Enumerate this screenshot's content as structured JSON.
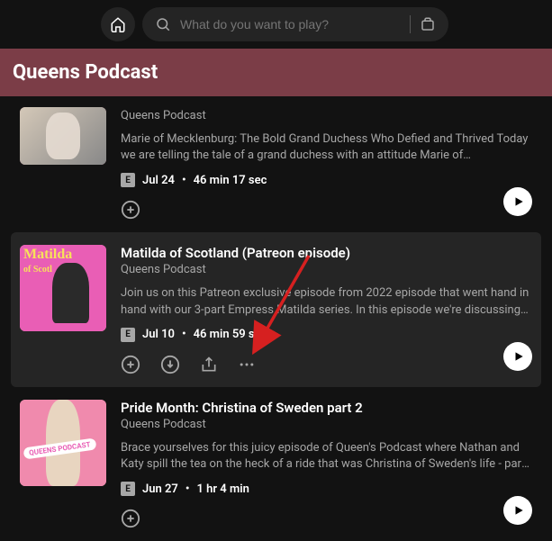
{
  "search": {
    "placeholder": "What do you want to play?"
  },
  "banner": {
    "title": "Queens Podcast"
  },
  "explicit_label": "E",
  "episodes": [
    {
      "show": "Queens Podcast",
      "desc": "Marie of Mecklenburg: The Bold Grand Duchess Who Defied and Thrived Today we are telling the tale of a grand duchess with an attitude Marie of Mecklenburg! She's the onl...",
      "date": "Jul 24",
      "duration": "46 min 17 sec",
      "art_label_line1": "",
      "art_label_line2": ""
    },
    {
      "title": "Matilda of Scotland (Patreon episode)",
      "show": "Queens Podcast",
      "desc": "Join us on this Patreon exclusive episode from 2022 episode that went hand in hand with our 3-part Empress Matilda series. In this episode we're discussing Empress...",
      "date": "Jul 10",
      "duration": "46 min 59 sec",
      "art_label_line1": "Matilda",
      "art_label_line2": "of Scotl"
    },
    {
      "title": "Pride Month: Christina of Sweden part 2",
      "show": "Queens Podcast",
      "desc": "Brace yourselves for this juicy episode of Queen's Podcast where Nathan and Katy spill the tea on the heck of a ride that was Christina of Sweden's life - part two! This queen's...",
      "date": "Jun 27",
      "duration": "1 hr 4 min",
      "art_tag": "QUEENS PODCAST"
    }
  ]
}
